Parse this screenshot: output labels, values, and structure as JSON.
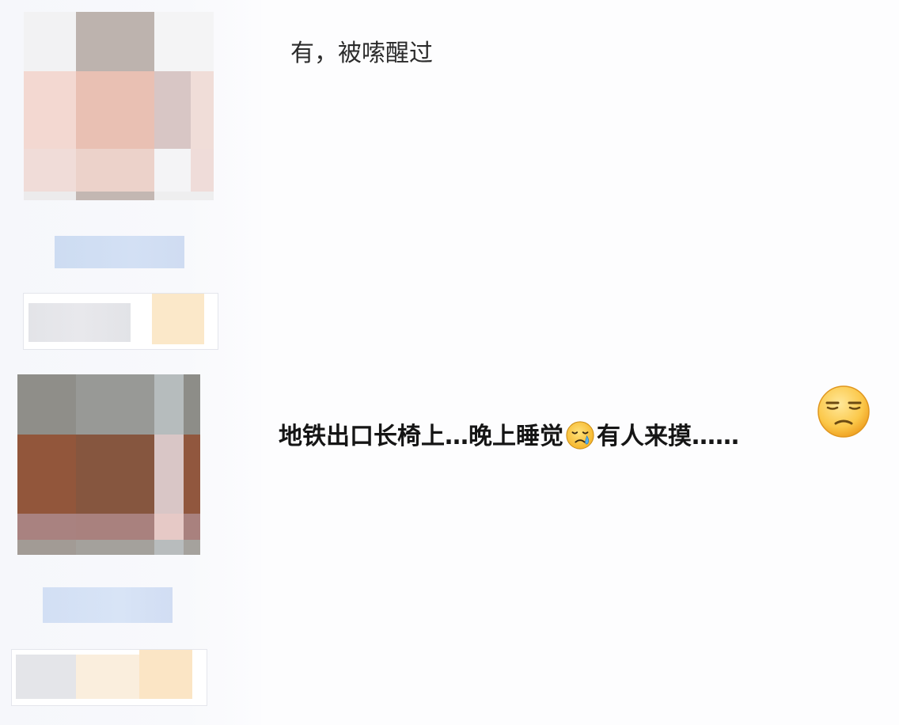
{
  "comments": [
    {
      "text": "有，被嗦醒过"
    },
    {
      "text_before_emoji": "地铁出口长椅上…晚上睡觉",
      "inline_emoji": "sad-relieved-face-icon",
      "text_after_emoji": "有人来摸……",
      "trailing_emoji": "unamused-face-icon"
    }
  ],
  "avatars": [
    {
      "name": "blurred-avatar-1",
      "mosaic_colors": [
        [
          "#f2f2f3",
          "#bdb3ae",
          "#f4f4f5",
          "#f4f4f5"
        ],
        [
          "#f3d8d1",
          "#e9c0b3",
          "#d8c6c5",
          "#f0ddd8"
        ],
        [
          "#f0dcd8",
          "#ecd2ca",
          "#f4f4f6",
          "#efdcd9"
        ],
        [
          "#ecebec",
          "#c3b7b2",
          "#eeeeef",
          "#eeeeef"
        ]
      ]
    },
    {
      "name": "blurred-avatar-2",
      "mosaic_colors": [
        [
          "#8f8e89",
          "#989996",
          "#b6bcbd",
          "#8d8d88"
        ],
        [
          "#92563b",
          "#86563f",
          "#d9c6c6",
          "#91573e"
        ],
        [
          "#a98280",
          "#a9817e",
          "#e6c9c6",
          "#a9817e"
        ],
        [
          "#a29b95",
          "#a4a19c",
          "#b8bcbd",
          "#a5a29d"
        ]
      ]
    }
  ],
  "colors": {
    "background": "#fdfdfe",
    "sidebar": "#f7f8fb",
    "blurred_name_bar": "#d0ddf3",
    "blurred_info_gray": "#e4e5e9",
    "blurred_info_cream": "#fbe6c8",
    "text_primary": "#151515"
  }
}
